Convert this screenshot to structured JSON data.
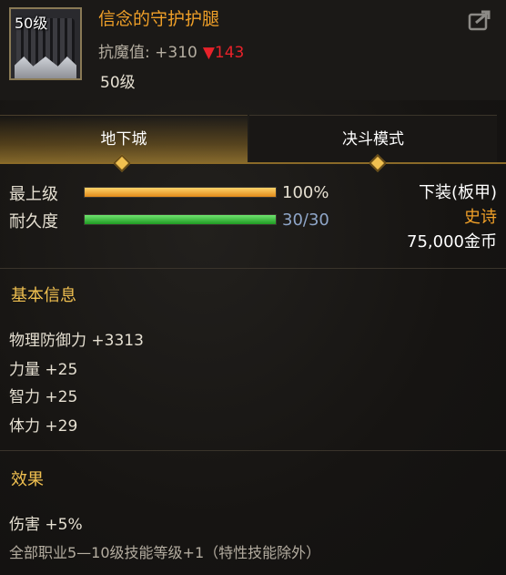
{
  "item": {
    "icon_level": "50级",
    "name": "信念的守护护腿",
    "resist_label": "抗魔值: +310",
    "resist_down": "▼143",
    "level": "50级"
  },
  "tabs": [
    {
      "label": "地下城",
      "active": true
    },
    {
      "label": "决斗模式",
      "active": false
    }
  ],
  "stats": {
    "max_label": "最上级",
    "max_value": "100%",
    "max_fraction": 1.0,
    "durability_label": "耐久度",
    "durability_value": "30/30",
    "durability_fraction": 1.0
  },
  "info": {
    "slot": "下装(板甲)",
    "rarity": "史诗",
    "price": "75,000金币"
  },
  "basic": {
    "title": "基本信息",
    "attrs": [
      "物理防御力 +3313",
      "力量 +25",
      "智力 +25",
      "体力 +29"
    ]
  },
  "effects": {
    "title": "效果",
    "lines": [
      "伤害 +5%",
      "全部职业5—10级技能等级+1（特性技能除外）"
    ]
  },
  "colors": {
    "name": "#f0a028",
    "rarity": "#f0a028",
    "resist_down": "#e8222a",
    "section_title": "#f0c050",
    "durability_value": "#8fa6c8"
  },
  "icons": {
    "share": "share-arrow-icon",
    "item": "greaves-icon"
  }
}
